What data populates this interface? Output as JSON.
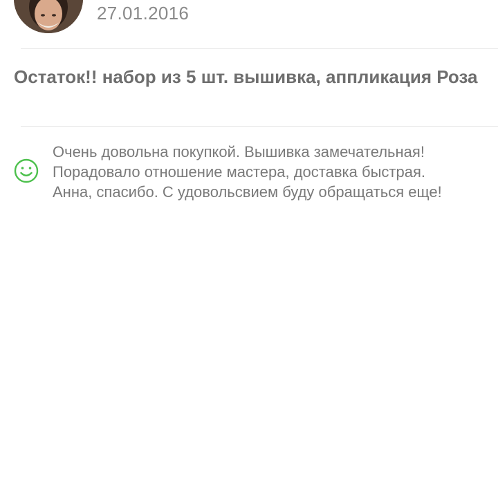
{
  "review": {
    "date": "27.01.2016",
    "product_title": "Остаток!! набор из 5 шт. вышивка, аппликация Роза",
    "rating_icon": "smiley-positive-icon",
    "rating_color": "#4cc04c",
    "text_lines": [
      "Очень довольна покупкой. Вышивка замечательная!",
      "Порадовало отношение  мастера, доставка быстрая.",
      "Анна, спасибо. С удовольсвием буду обращаться еще!"
    ]
  }
}
